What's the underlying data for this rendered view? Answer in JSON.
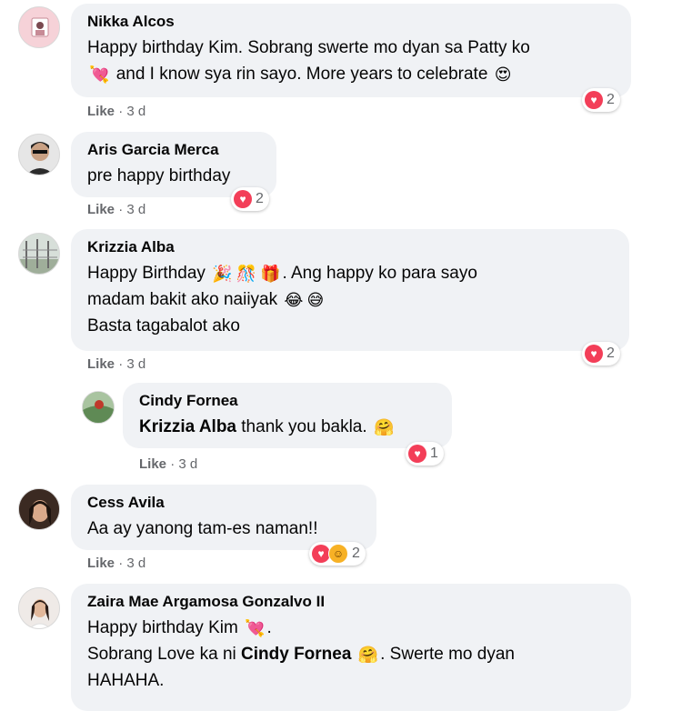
{
  "comments": [
    {
      "name": "Nikka Alcos",
      "lines": [
        "Happy birthday Kim. Sobrang swerte mo dyan sa Patty ko",
        "and I know sya rin sayo. More years to celebrate"
      ],
      "like_label": "Like",
      "time": "3 d",
      "reaction_count": "2"
    },
    {
      "name": "Aris Garcia Merca",
      "lines": [
        "pre happy birthday"
      ],
      "like_label": "Like",
      "time": "3 d",
      "reaction_count": "2"
    },
    {
      "name": "Krizzia Alba",
      "lines": [
        "Happy Birthday",
        ". Ang happy ko para sayo",
        "madam bakit ako naiiyak",
        "Basta tagabalot ako"
      ],
      "like_label": "Like",
      "time": "3 d",
      "reaction_count": "2"
    },
    {
      "name": "Cindy Fornea",
      "mention": "Krizzia Alba",
      "lines": [
        " thank you bakla."
      ],
      "like_label": "Like",
      "time": "3 d",
      "reaction_count": "1"
    },
    {
      "name": "Cess Avila",
      "lines": [
        "Aa ay yanong tam-es naman!!"
      ],
      "like_label": "Like",
      "time": "3 d",
      "reaction_count": "2"
    },
    {
      "name": "Zaira Mae Argamosa Gonzalvo II",
      "lines": [
        "Happy birthday Kim",
        "Sobrang Love ka ni ",
        "Cindy Fornea",
        ". Swerte mo dyan",
        "HAHAHA."
      ]
    }
  ],
  "separator": "·",
  "colors": {
    "bubble": "#f0f2f5",
    "meta": "#65676b",
    "love": "#f33e58",
    "haha": "#f7b125"
  }
}
